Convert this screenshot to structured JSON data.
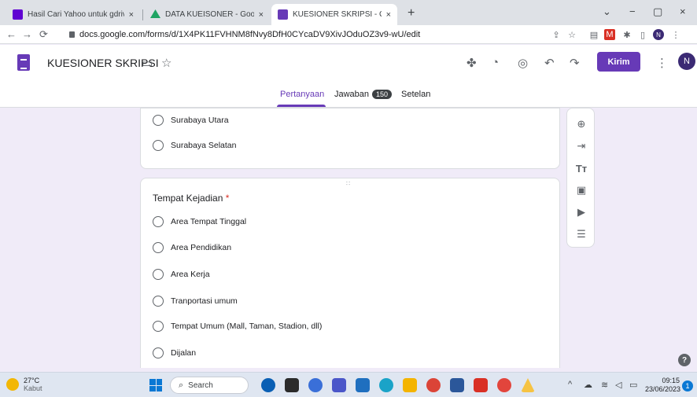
{
  "browser": {
    "tabs": [
      {
        "title": "Hasil Cari Yahoo untuk gdrive",
        "favicon_color": "#6001d2"
      },
      {
        "title": "DATA KUEISONER - Google Drive",
        "favicon_color": "#1fa463"
      },
      {
        "title": "KUESIONER SKRIPSI - Google For",
        "favicon_color": "#673ab7"
      }
    ],
    "close_glyph": "×",
    "new_tab_glyph": "+",
    "window_controls": [
      "⌄",
      "−",
      "▢",
      "×"
    ],
    "url": "docs.google.com/forms/d/1X4PK11FVHNM8fNvy8DfH0CYcaDV9XivJOduOZ3v9-wU/edit"
  },
  "form": {
    "title": "KUESIONER SKRIPSI",
    "send_label": "Kirim",
    "avatar_letter": "N",
    "tabs": {
      "questions": "Pertanyaan",
      "responses": "Jawaban",
      "responses_count": "150",
      "settings": "Setelan"
    }
  },
  "card1": {
    "options": [
      "Surabaya Utara",
      "Surabaya Selatan"
    ]
  },
  "card2": {
    "question": "Tempat Kejadian",
    "required_mark": "*",
    "options": [
      "Area Tempat Tinggal",
      "Area Pendidikan",
      "Area Kerja",
      "Tranportasi umum",
      "Tempat Umum (Mall, Taman, Stadion, dll)",
      "Dijalan"
    ]
  },
  "taskbar": {
    "temperature": "27°C",
    "weather": "Kabut",
    "search_label": "Search",
    "time": "09:15",
    "date": "23/06/2023",
    "notification_count": "1"
  },
  "colors": {
    "accent": "#673ab7",
    "background": "#f0ebf8"
  }
}
